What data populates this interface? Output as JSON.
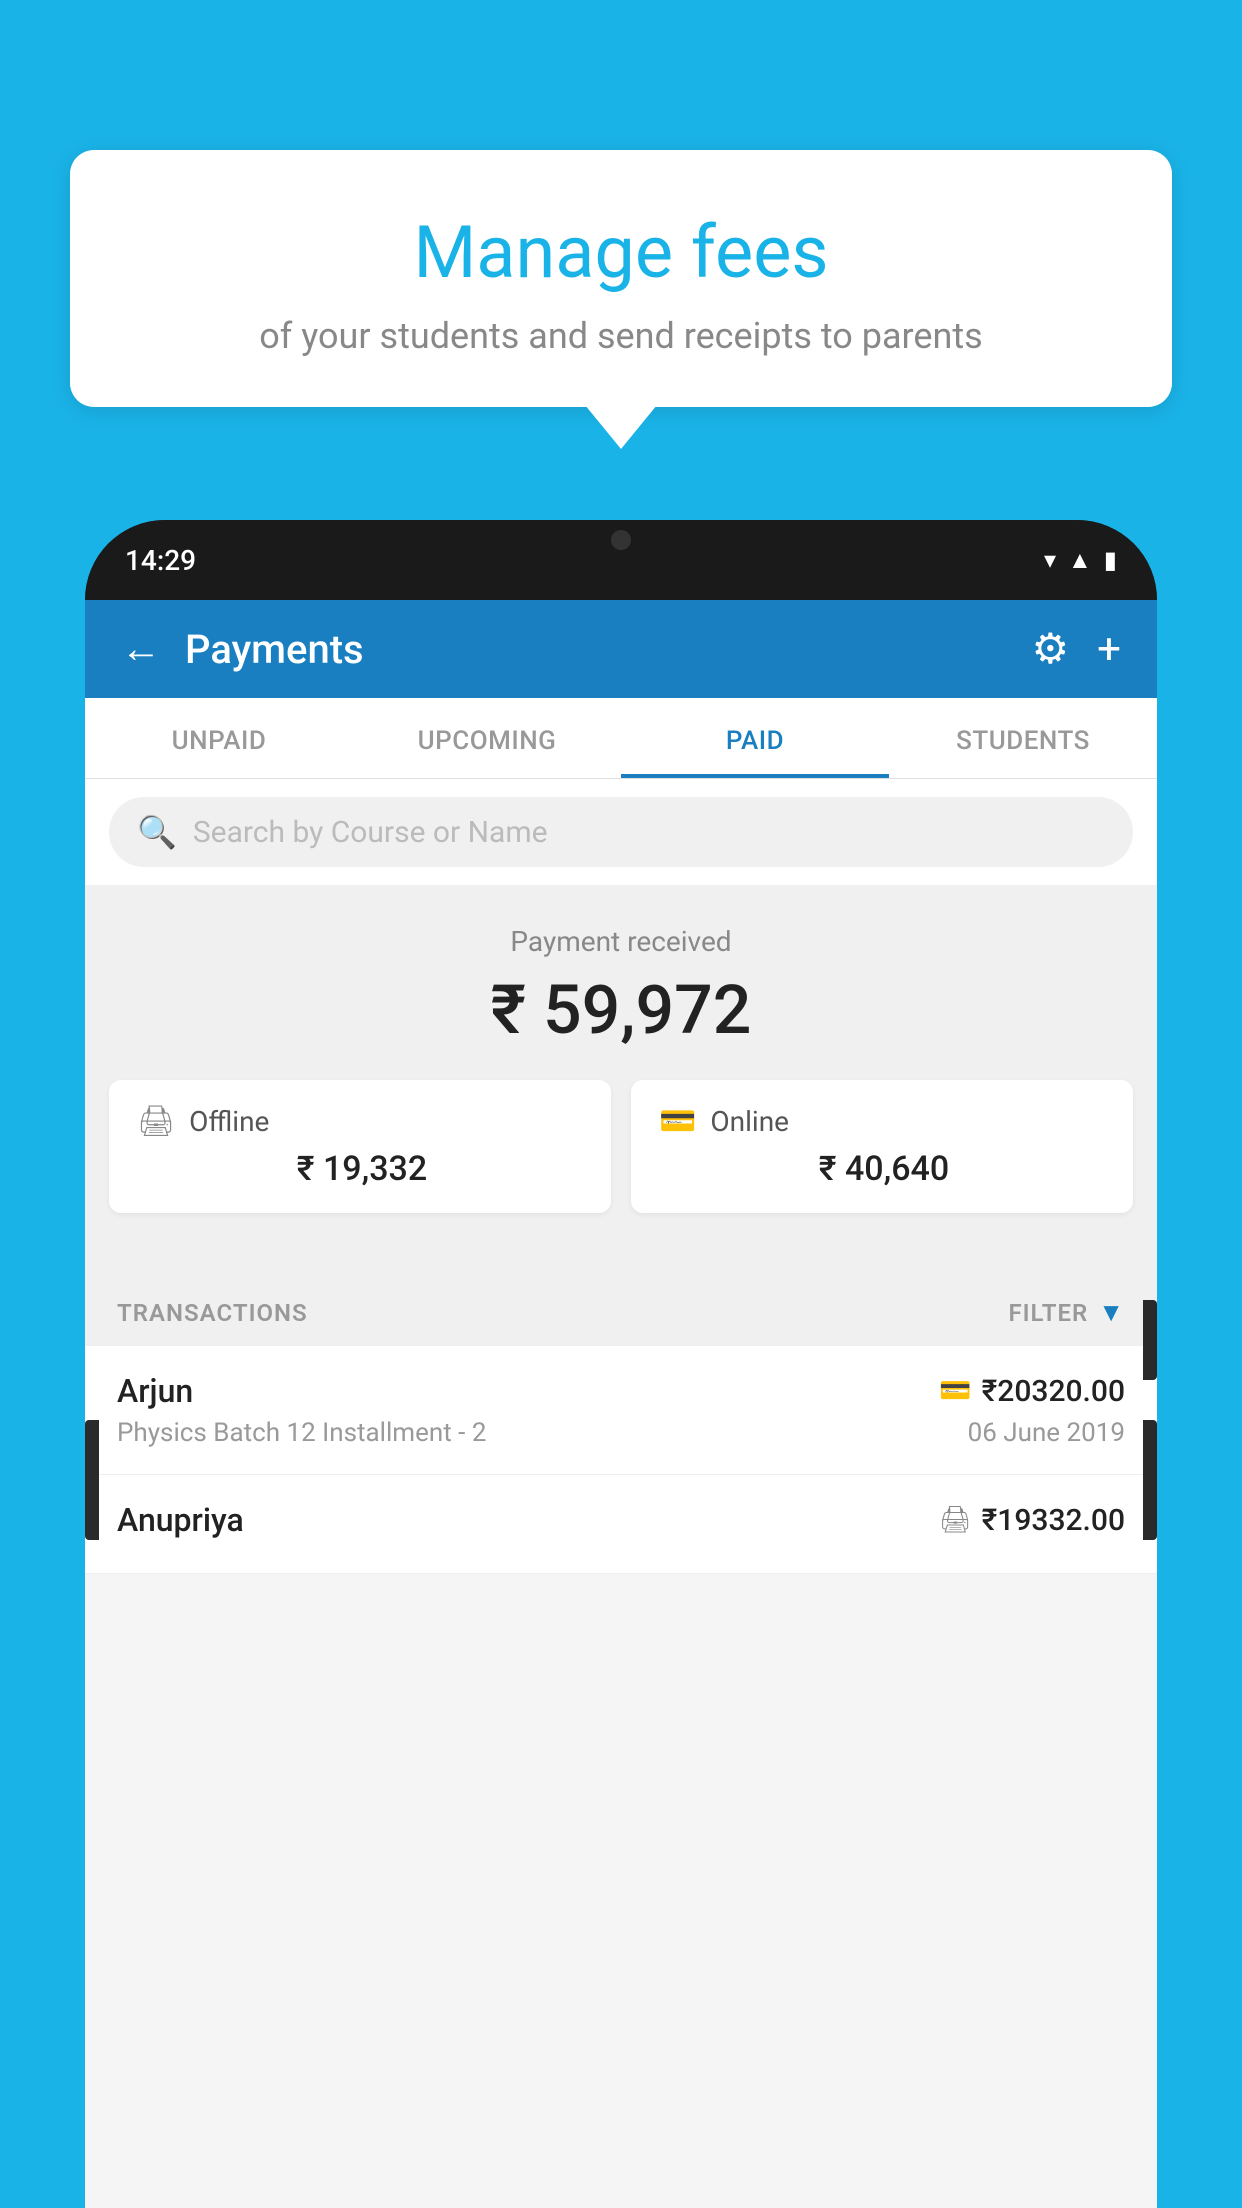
{
  "page": {
    "background_color": "#1ab3e8"
  },
  "speech_bubble": {
    "title": "Manage fees",
    "subtitle": "of your students and send receipts to parents"
  },
  "phone": {
    "time": "14:29",
    "header": {
      "title": "Payments",
      "back_label": "←",
      "settings_label": "⚙",
      "add_label": "+"
    },
    "tabs": [
      {
        "label": "UNPAID",
        "active": false
      },
      {
        "label": "UPCOMING",
        "active": false
      },
      {
        "label": "PAID",
        "active": true
      },
      {
        "label": "STUDENTS",
        "active": false
      }
    ],
    "search": {
      "placeholder": "Search by Course or Name"
    },
    "payment_summary": {
      "label": "Payment received",
      "amount": "₹ 59,972",
      "offline": {
        "icon": "offline",
        "label": "Offline",
        "amount": "₹ 19,332"
      },
      "online": {
        "icon": "online",
        "label": "Online",
        "amount": "₹ 40,640"
      }
    },
    "transactions": {
      "section_label": "TRANSACTIONS",
      "filter_label": "FILTER",
      "items": [
        {
          "name": "Arjun",
          "course": "Physics Batch 12 Installment - 2",
          "amount": "₹20320.00",
          "date": "06 June 2019",
          "method": "card"
        },
        {
          "name": "Anupriya",
          "course": "",
          "amount": "₹19332.00",
          "date": "",
          "method": "cash"
        }
      ]
    }
  }
}
